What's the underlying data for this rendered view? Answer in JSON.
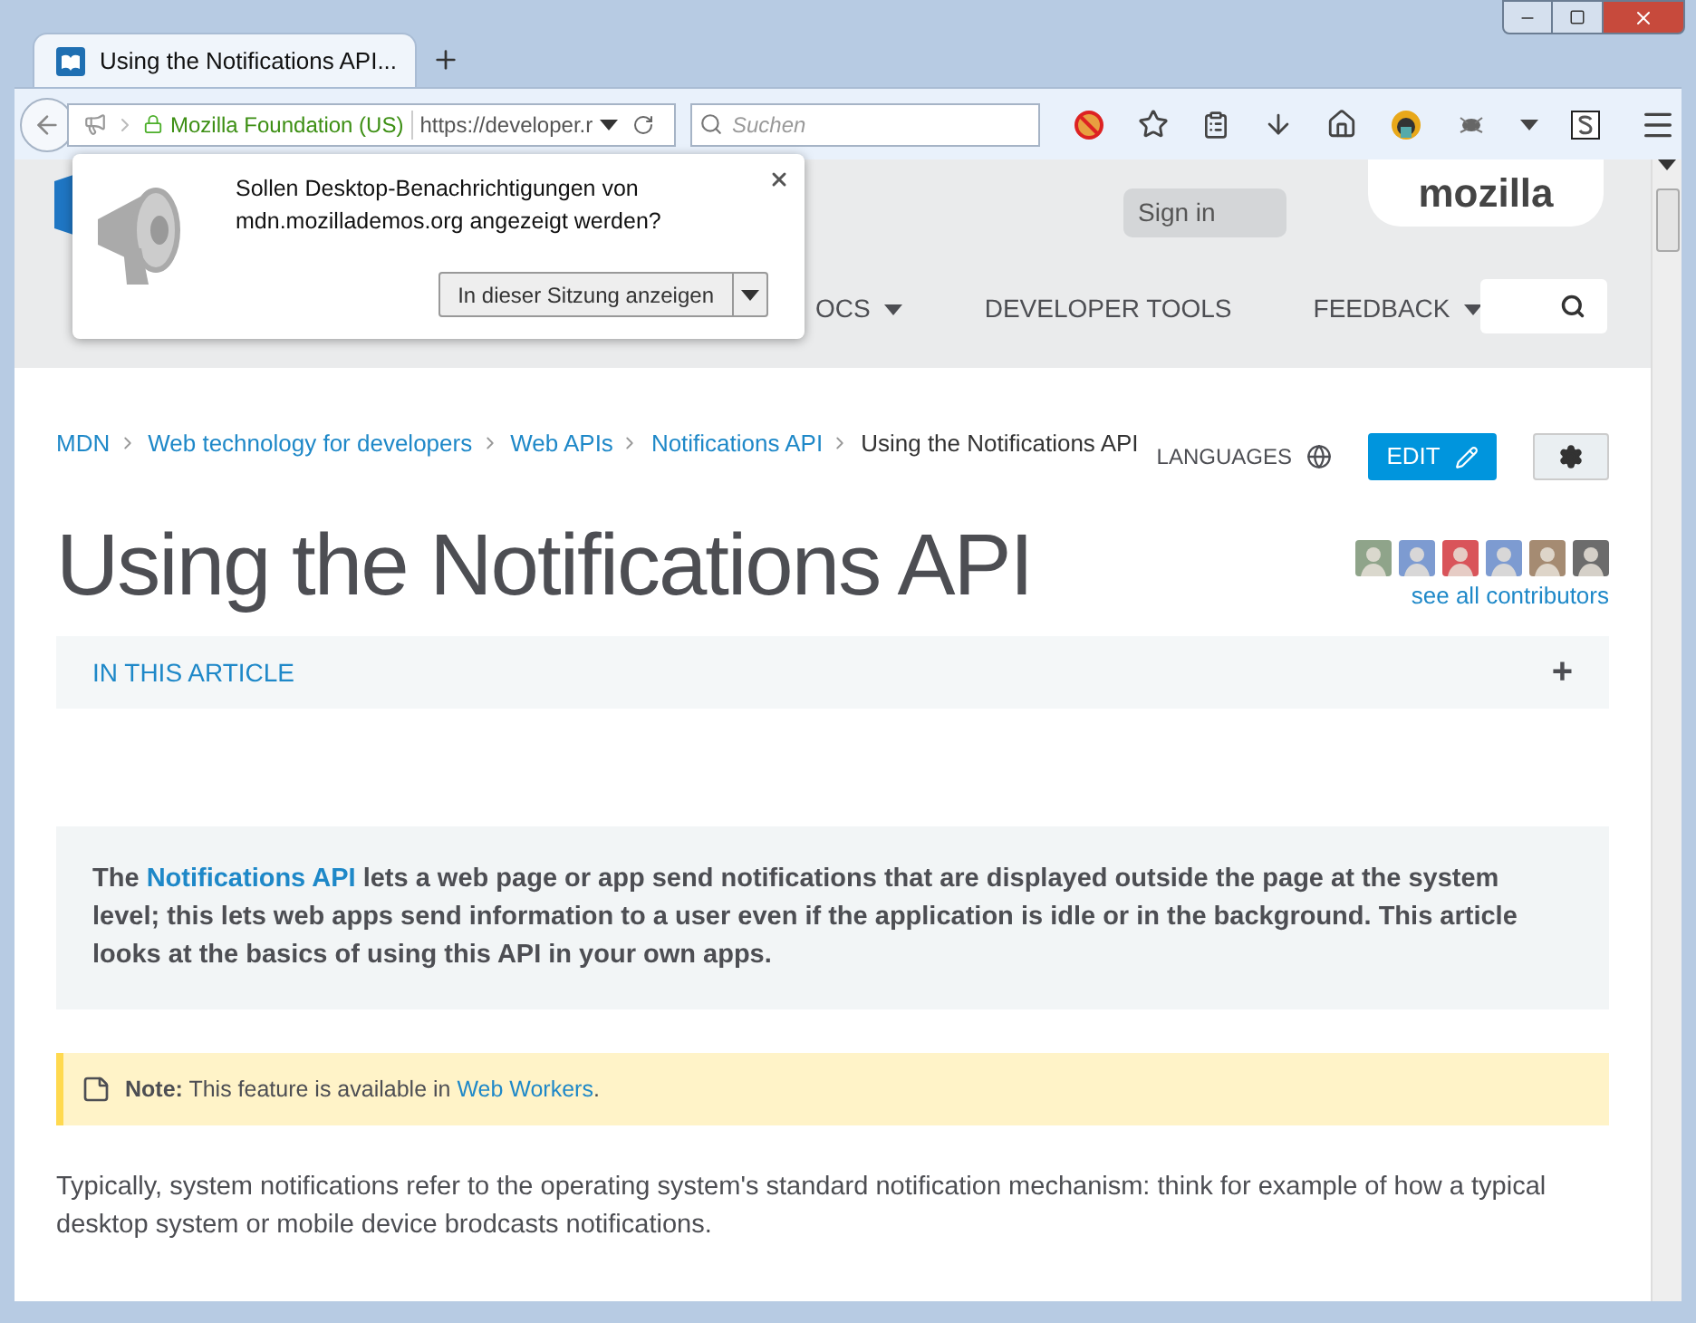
{
  "tab": {
    "title": "Using the Notifications API..."
  },
  "toolbar": {
    "identity": "Mozilla Foundation (US)",
    "url": "https://developer.r",
    "search_placeholder": "Suchen"
  },
  "popup": {
    "message": "Sollen Desktop-Benachrichtigungen von mdn.mozillademos.org angezeigt werden?",
    "button": {
      "label": "In dieser Sitzung anzeigen"
    }
  },
  "header": {
    "sign_in": "Sign in",
    "logo": "mozilla",
    "nav": [
      {
        "label": "OCS",
        "dropdown": true
      },
      {
        "label": "DEVELOPER TOOLS",
        "dropdown": false
      },
      {
        "label": "FEEDBACK",
        "dropdown": true
      }
    ]
  },
  "breadcrumbs": [
    {
      "label": "MDN",
      "current": false
    },
    {
      "label": "Web technology for developers",
      "current": false
    },
    {
      "label": "Web APIs",
      "current": false
    },
    {
      "label": "Notifications API",
      "current": false
    },
    {
      "label": "Using the Notifications API",
      "current": true
    }
  ],
  "actions": {
    "languages": "LANGUAGES",
    "edit": "EDIT"
  },
  "title": "Using the Notifications API",
  "contributors_link": "see all contributors",
  "toc": {
    "label": "IN THIS ARTICLE",
    "toggle": "+"
  },
  "summary": {
    "before": "The ",
    "link": "Notifications API",
    "after": " lets a web page or app send notifications that are displayed outside the page at the system level; this lets web apps send information to a user even if the application is idle or in the background. This article looks at the basics of using this API in your own apps."
  },
  "note": {
    "text": "**Note:** This feature is available in ",
    "link": "Web Workers",
    "after": "."
  },
  "paragraph": "Typically, system notifications refer to the operating system's standard notification mechanism: think for example of how a typical desktop system or mobile device brodcasts notifications."
}
